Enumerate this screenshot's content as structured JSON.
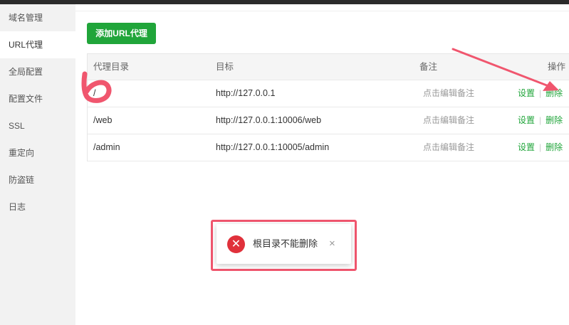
{
  "sidebar": {
    "items": [
      {
        "label": "域名管理"
      },
      {
        "label": "URL代理"
      },
      {
        "label": "全局配置"
      },
      {
        "label": "配置文件"
      },
      {
        "label": "SSL"
      },
      {
        "label": "重定向"
      },
      {
        "label": "防盗链"
      },
      {
        "label": "日志"
      }
    ],
    "active_index": 1
  },
  "toolbar": {
    "add_label": "添加URL代理"
  },
  "table": {
    "headers": {
      "dir": "代理目录",
      "target": "目标",
      "note": "备注",
      "ops": "操作"
    },
    "rows": [
      {
        "dir": "/",
        "target": "http://127.0.0.1",
        "note": "点击编辑备注",
        "settings": "设置",
        "delete": "删除"
      },
      {
        "dir": "/web",
        "target": "http://127.0.0.1:10006/web",
        "note": "点击编辑备注",
        "settings": "设置",
        "delete": "删除"
      },
      {
        "dir": "/admin",
        "target": "http://127.0.0.1:10005/admin",
        "note": "点击编辑备注",
        "settings": "设置",
        "delete": "删除"
      }
    ]
  },
  "toast": {
    "message": "根目录不能删除",
    "close_symbol": "×",
    "icon": "error-icon",
    "icon_symbol": "✕"
  },
  "colors": {
    "accent": "#20a53a",
    "error": "#e0313b",
    "annotation": "#f0566e"
  }
}
